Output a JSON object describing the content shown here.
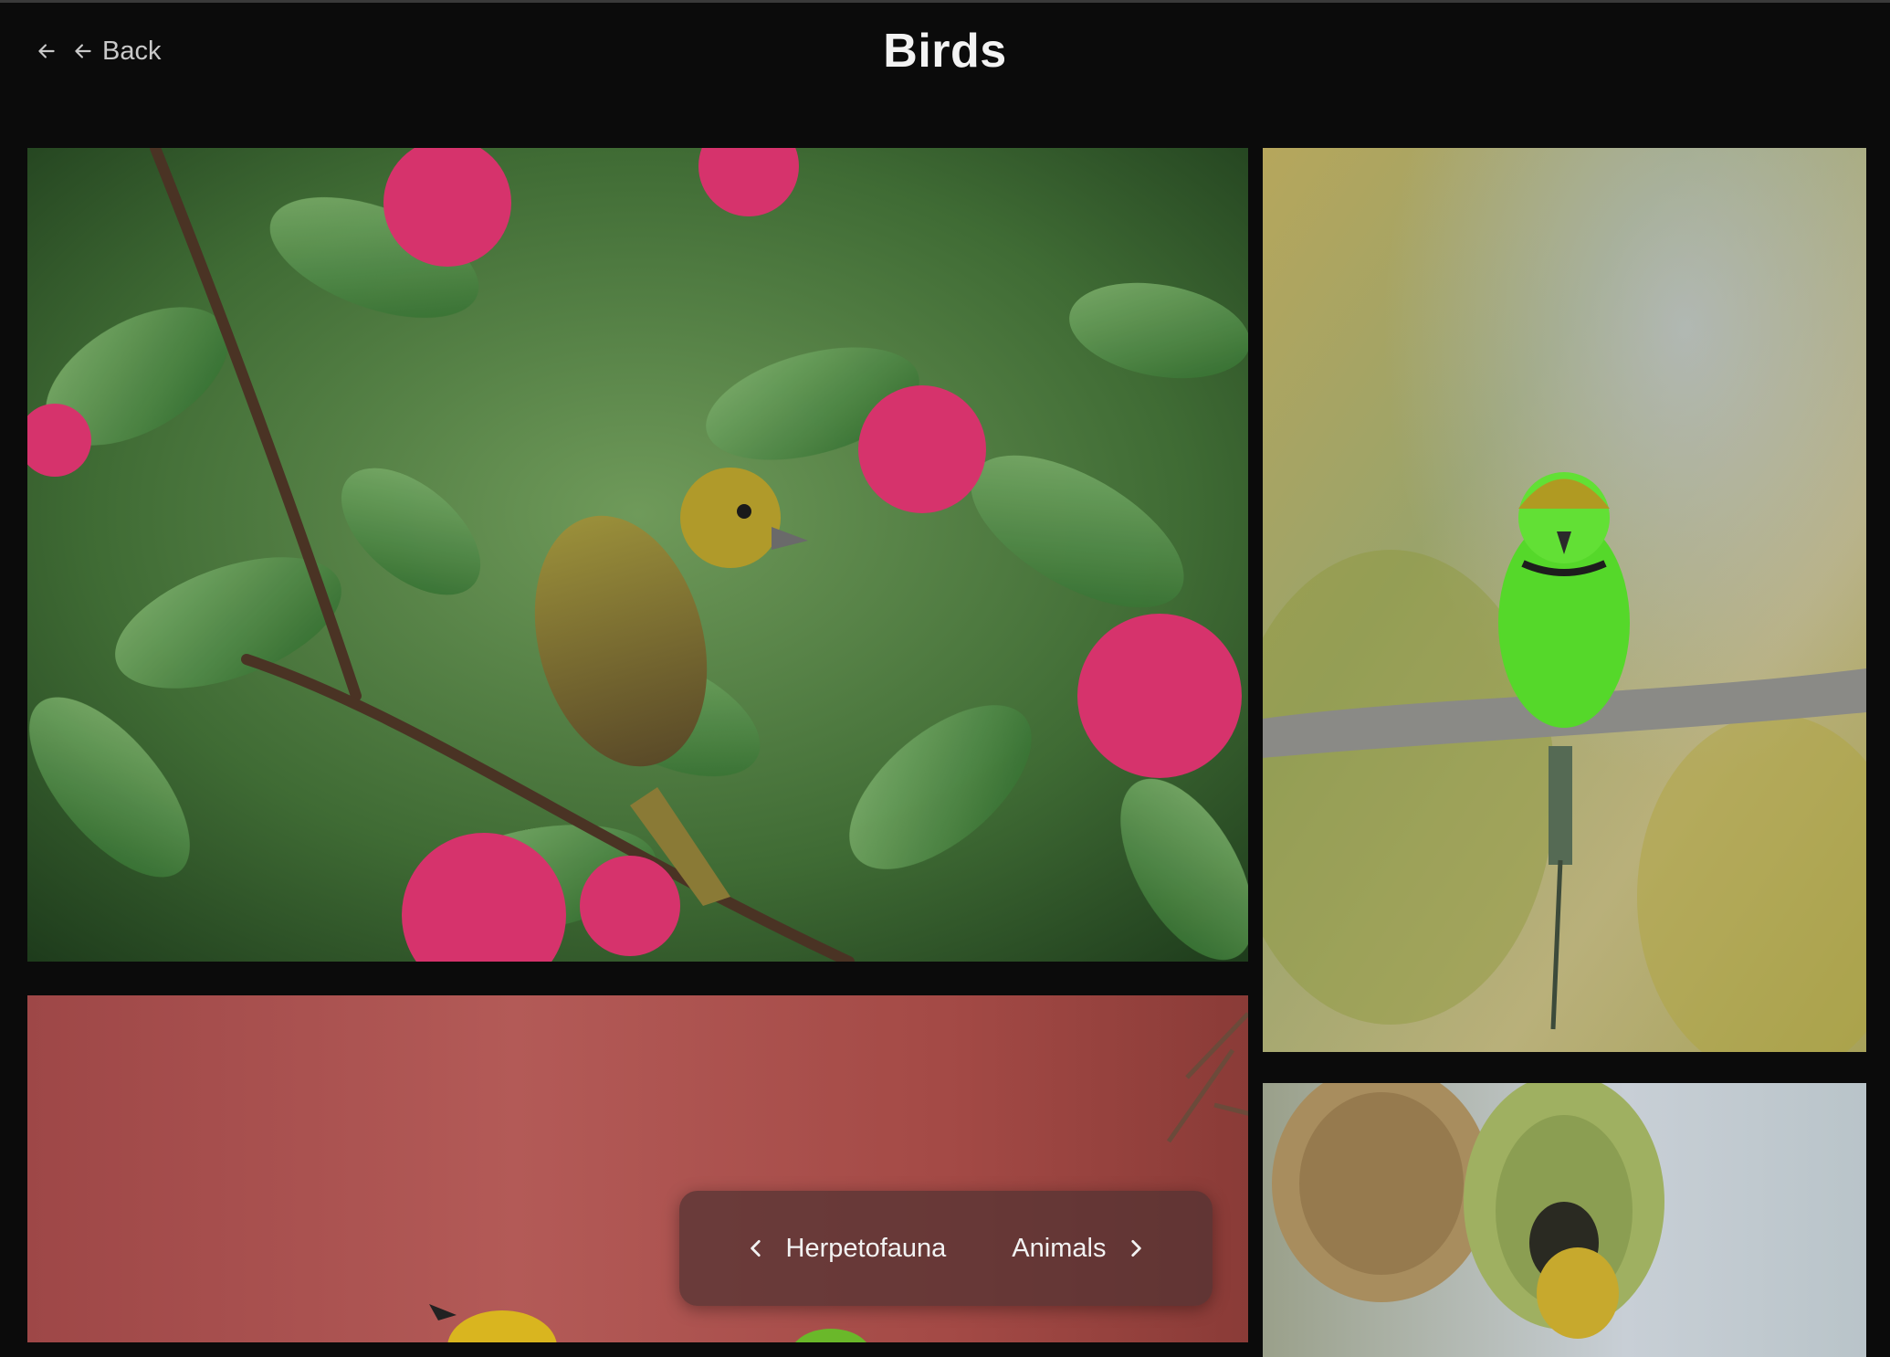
{
  "header": {
    "back_label": "Back",
    "title": "Birds"
  },
  "gallery": {
    "tiles": [
      {
        "subject": "yellow-headed weaver bird among pink bougainvillea flowers"
      },
      {
        "subject": "green bee-eater perched on branch"
      },
      {
        "subject": "bee-eaters against red background"
      },
      {
        "subject": "weaver bird nests"
      }
    ]
  },
  "pager": {
    "prev_label": "Herpetofauna",
    "next_label": "Animals"
  },
  "colors": {
    "background": "#0b0b0b",
    "title_text": "#f3f3f3",
    "pill_background": "rgba(80,50,50,0.72)"
  },
  "icons": {
    "back": "arrow-left-icon",
    "prev": "chevron-left-icon",
    "next": "chevron-right-icon"
  }
}
